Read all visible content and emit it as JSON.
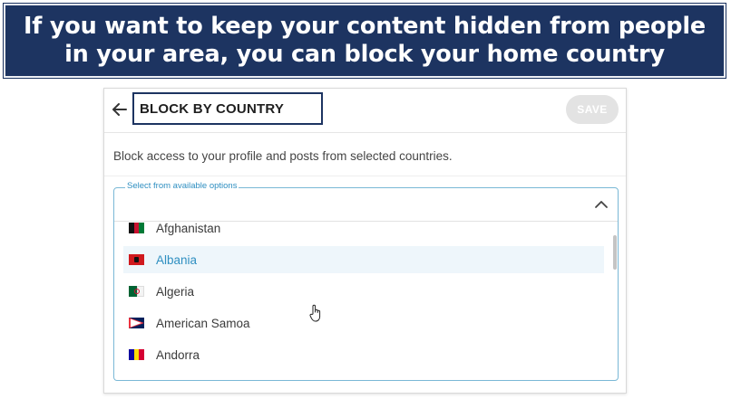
{
  "banner": {
    "line1": "If you want to keep your content hidden from people",
    "line2": "in your area, you can block your home country"
  },
  "header": {
    "title": "BLOCK BY COUNTRY",
    "save_label": "SAVE"
  },
  "description": "Block access to your profile and posts from selected countries.",
  "select": {
    "legend": "Select from available options",
    "options": [
      {
        "label": "Afghanistan",
        "flag": "afghanistan-flag-icon"
      },
      {
        "label": "Albania",
        "flag": "albania-flag-icon",
        "highlighted": true
      },
      {
        "label": "Algeria",
        "flag": "algeria-flag-icon"
      },
      {
        "label": "American Samoa",
        "flag": "american-samoa-flag-icon"
      },
      {
        "label": "Andorra",
        "flag": "andorra-flag-icon"
      }
    ]
  },
  "colors": {
    "banner_bg": "#1d3461",
    "accent": "#2f8fc1",
    "highlight_bg": "#eef6fb"
  }
}
